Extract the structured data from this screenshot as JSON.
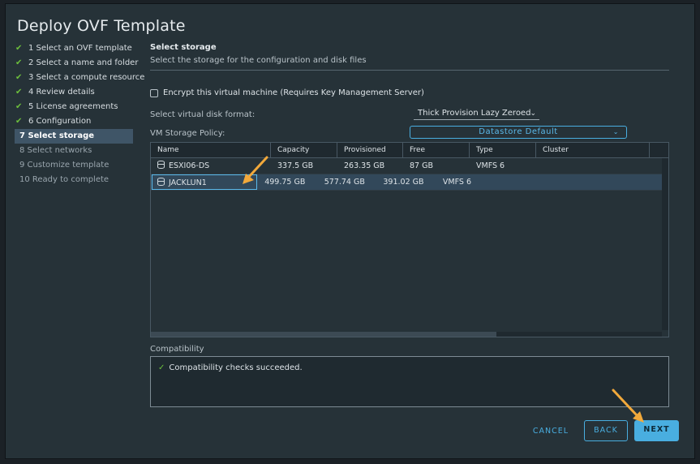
{
  "dialog": {
    "title": "Deploy OVF Template"
  },
  "steps": [
    {
      "label": "1 Select an OVF template",
      "state": "done"
    },
    {
      "label": "2 Select a name and folder",
      "state": "done"
    },
    {
      "label": "3 Select a compute resource",
      "state": "done"
    },
    {
      "label": "4 Review details",
      "state": "done"
    },
    {
      "label": "5 License agreements",
      "state": "done"
    },
    {
      "label": "6 Configuration",
      "state": "done"
    },
    {
      "label": "7 Select storage",
      "state": "active"
    },
    {
      "label": "8 Select networks",
      "state": "pending"
    },
    {
      "label": "9 Customize template",
      "state": "pending"
    },
    {
      "label": "10 Ready to complete",
      "state": "pending"
    }
  ],
  "section": {
    "heading": "Select storage",
    "subtitle": "Select the storage for the configuration and disk files"
  },
  "encrypt": {
    "label": "Encrypt this virtual machine (Requires Key Management Server)",
    "checked": false
  },
  "disk_format": {
    "label": "Select virtual disk format:",
    "value": "Thick Provision Lazy Zeroed"
  },
  "storage_policy": {
    "label": "VM Storage Policy:",
    "value": "Datastore Default"
  },
  "table": {
    "headers": [
      "Name",
      "Capacity",
      "Provisioned",
      "Free",
      "Type",
      "Cluster"
    ],
    "rows": [
      {
        "name": "ESXI06-DS",
        "capacity": "337.5 GB",
        "provisioned": "263.35 GB",
        "free": "87 GB",
        "type": "VMFS 6",
        "cluster": "",
        "selected": false
      },
      {
        "name": "JACKLUN1",
        "capacity": "499.75 GB",
        "provisioned": "577.74 GB",
        "free": "391.02 GB",
        "type": "VMFS 6",
        "cluster": "",
        "selected": true
      }
    ]
  },
  "compatibility": {
    "label": "Compatibility",
    "message": "Compatibility checks succeeded."
  },
  "buttons": {
    "cancel": "CANCEL",
    "back": "BACK",
    "next": "NEXT"
  },
  "colors": {
    "accent": "#49aee0",
    "check": "#6cbf3c",
    "annotation_arrow": "#f2a93b",
    "dialog_bg": "#263238"
  }
}
